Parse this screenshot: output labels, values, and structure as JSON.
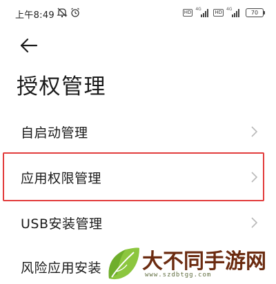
{
  "status_bar": {
    "time": "上午8:49",
    "left_icons": [
      "mute-icon",
      "alarm-icon"
    ],
    "hd_badge": "HD",
    "network": "4G",
    "battery": "70"
  },
  "header": {
    "back_icon": "arrow-left-icon",
    "title": "授权管理"
  },
  "menu": {
    "items": [
      {
        "label": "自启动管理"
      },
      {
        "label": "应用权限管理",
        "highlighted": true
      },
      {
        "label": "USB安装管理"
      },
      {
        "label": "风险应用安装"
      }
    ],
    "chevron_icon": "chevron-right-icon"
  },
  "colors": {
    "highlight_border": "#e23b3b",
    "text": "#1a1a1a",
    "chevron": "#b8b8b8"
  },
  "watermark": {
    "text": "大不同手游网",
    "url": "www.szdbtgg.com",
    "logo_icon": "leaf-logo-icon"
  }
}
